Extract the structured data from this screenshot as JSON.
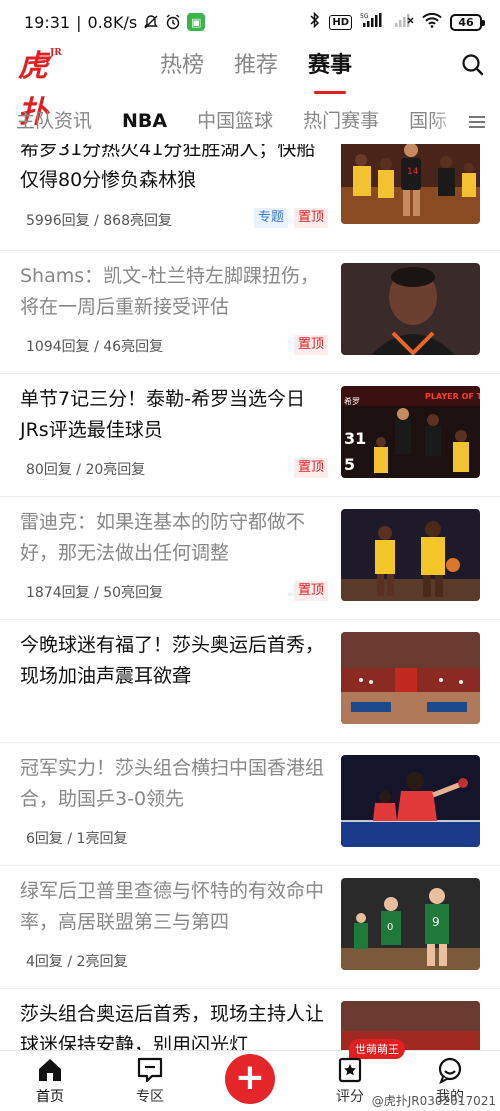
{
  "status_bar": {
    "time": "19:31",
    "speed": "0.8K/s",
    "network": "5G",
    "battery": "46"
  },
  "header": {
    "logo_text": "虎扑",
    "logo_sup": "JR",
    "tabs": [
      {
        "label": "热榜",
        "active": false
      },
      {
        "label": "推荐",
        "active": false
      },
      {
        "label": "赛事",
        "active": true
      }
    ]
  },
  "categories": [
    {
      "label": "主队资讯",
      "active": false
    },
    {
      "label": "NBA",
      "active": true
    },
    {
      "label": "中国篮球",
      "active": false
    },
    {
      "label": "热门赛事",
      "active": false
    },
    {
      "label": "国际",
      "active": false
    }
  ],
  "feed": [
    {
      "title": "希罗31分热火41分狂胜湖人；快船仅得80分惨负森林狼",
      "read": false,
      "replies": "5996回复",
      "lights": "868亮回复",
      "tags": [
        "专题",
        "置顶"
      ],
      "thumb": "miami-heat-players"
    },
    {
      "title": "Shams：凯文-杜兰特左脚踝扭伤，将在一周后重新接受评估",
      "read": true,
      "replies": "1094回复",
      "lights": "46亮回复",
      "tags": [
        "置顶"
      ],
      "thumb": "durant-portrait"
    },
    {
      "title": "单节7记三分！泰勒-希罗当选今日JRs评选最佳球员",
      "read": false,
      "replies": "80回复",
      "lights": "20亮回复",
      "tags": [
        "置顶"
      ],
      "thumb": "herro-player-of-day",
      "thumb_text": [
        "希罗",
        "31",
        "5",
        "PLAYER OF THE DAY"
      ]
    },
    {
      "title": "雷迪克：如果连基本的防守都做不好，那无法做出任何调整",
      "read": true,
      "replies": "1874回复",
      "lights": "50亮回复",
      "tags": [
        "置顶"
      ],
      "thumb": "lakers-players"
    },
    {
      "title": "今晚球迷有福了！莎头奥运后首秀，现场加油声震耳欲聋",
      "read": false,
      "replies": "",
      "lights": "",
      "tags": [],
      "thumb": "arena-crowd"
    },
    {
      "title": "冠军实力！莎头组合横扫中国香港组合，助国乒3-0领先",
      "read": true,
      "replies": "6回复",
      "lights": "1亮回复",
      "tags": [],
      "thumb": "table-tennis"
    },
    {
      "title": "绿军后卫普里查德与怀特的有效命中率，高居联盟第三与第四",
      "read": true,
      "replies": "4回复",
      "lights": "2亮回复",
      "tags": [],
      "thumb": "celtics-players"
    },
    {
      "title": "莎头组合奥运后首秀，现场主持人让球迷保持安静，别用闪光灯",
      "read": false,
      "replies": "",
      "lights": "",
      "tags": [],
      "thumb": "arena-red"
    }
  ],
  "bottom_nav": {
    "items": [
      {
        "label": "首页",
        "icon": "home-icon",
        "active": true
      },
      {
        "label": "专区",
        "icon": "chat-square-icon",
        "active": false
      },
      {
        "label": "评分",
        "icon": "star-icon",
        "active": false
      },
      {
        "label": "我的",
        "icon": "profile-icon",
        "active": false
      }
    ],
    "post_symbol": "+",
    "badge": "世萌萌王"
  },
  "watermark": "@虎扑JR0302017021",
  "colors": {
    "brand_red": "#e02020",
    "topic_blue": "#3a7bd5",
    "read_gray": "#888888"
  }
}
